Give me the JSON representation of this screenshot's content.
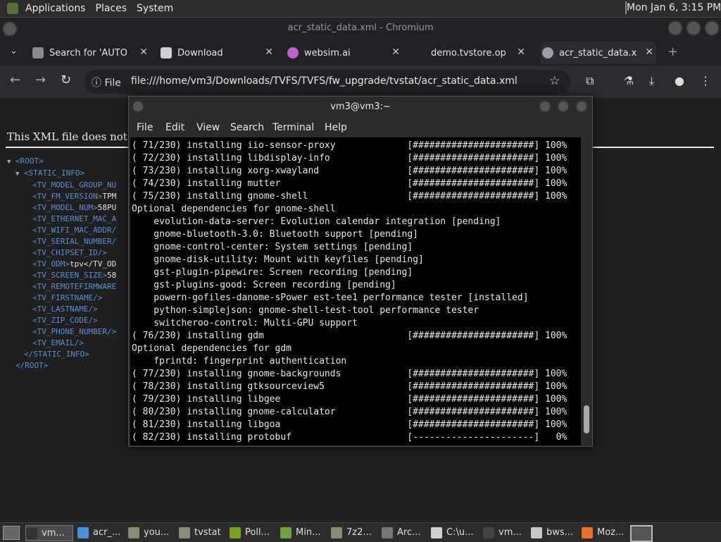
{
  "top_panel": {
    "menus": [
      "Applications",
      "Places",
      "System"
    ],
    "clock": "Mon Jan  6,  3:15 PM"
  },
  "browser": {
    "window_title": "acr_static_data.xml - Chromium",
    "tabs": [
      {
        "label": "Search for 'AUTOP",
        "icon": "puzzle-icon",
        "color": "#8a8a8a"
      },
      {
        "label": "Download",
        "icon": "tvfs-icon",
        "color": "#d0d0d0"
      },
      {
        "label": "websim.ai",
        "icon": "websim-icon",
        "color": "#c060d0"
      },
      {
        "label": "demo.tvstore.oper",
        "icon": "blank-icon",
        "color": "#202124"
      },
      {
        "label": "acr_static_data.xm",
        "icon": "globe-icon",
        "color": "#9aa0a6"
      }
    ],
    "info_label": "File",
    "url": "file:///home/vm3/Downloads/TVFS/TVFS/fw_upgrade/tvstat/acr_static_data.xml"
  },
  "xml_page": {
    "message": "This XML file does not app",
    "lines": [
      {
        "indent": 0,
        "tri": "▼",
        "text": "<ROOT>",
        "value": ""
      },
      {
        "indent": 1,
        "tri": "▼",
        "text": "<STATIC_INFO>",
        "value": ""
      },
      {
        "indent": 2,
        "tri": "",
        "text": "<TV_MODEL_GROUP_NU",
        "value": ""
      },
      {
        "indent": 2,
        "tri": "",
        "text": "<TV_FM_VERSION>",
        "value": "TPM"
      },
      {
        "indent": 2,
        "tri": "",
        "text": "<TV_MODEL_NUM>",
        "value": "58PU"
      },
      {
        "indent": 2,
        "tri": "",
        "text": "<TV_ETHERNET_MAC_A",
        "value": ""
      },
      {
        "indent": 2,
        "tri": "",
        "text": "<TV_WIFI_MAC_ADDR/",
        "value": ""
      },
      {
        "indent": 2,
        "tri": "",
        "text": "<TV_SERIAL_NUMBER/",
        "value": ""
      },
      {
        "indent": 2,
        "tri": "",
        "text": "<TV_CHIPSET_ID/>",
        "value": ""
      },
      {
        "indent": 2,
        "tri": "",
        "text": "<TV_ODM>",
        "value": "tpv</TV_OD"
      },
      {
        "indent": 2,
        "tri": "",
        "text": "<TV_SCREEN_SIZE>",
        "value": "58"
      },
      {
        "indent": 2,
        "tri": "",
        "text": "<TV_REMOTEFIRMWARE",
        "value": ""
      },
      {
        "indent": 2,
        "tri": "",
        "text": "<TV_FIRSTNAME/>",
        "value": ""
      },
      {
        "indent": 2,
        "tri": "",
        "text": "<TV_LASTNAME/>",
        "value": ""
      },
      {
        "indent": 2,
        "tri": "",
        "text": "<TV_ZIP_CODE/>",
        "value": ""
      },
      {
        "indent": 2,
        "tri": "",
        "text": "<TV_PHONE_NUMBER/>",
        "value": ""
      },
      {
        "indent": 2,
        "tri": "",
        "text": "<TV_EMAIL/>",
        "value": ""
      },
      {
        "indent": 1,
        "tri": "",
        "text": "</STATIC_INFO>",
        "value": ""
      },
      {
        "indent": 0,
        "tri": "",
        "text": "</ROOT>",
        "value": ""
      }
    ]
  },
  "terminal": {
    "title": "vm3@vm3:~",
    "menus": [
      "File",
      "Edit",
      "View",
      "Search",
      "Terminal",
      "Help"
    ],
    "lines": [
      "( 71/230) installing iio-sensor-proxy             [######################] 100%",
      "( 72/230) installing libdisplay-info              [######################] 100%",
      "( 73/230) installing xorg-xwayland                [######################] 100%",
      "( 74/230) installing mutter                       [######################] 100%",
      "( 75/230) installing gnome-shell                  [######################] 100%",
      "Optional dependencies for gnome-shell",
      "    evolution-data-server: Evolution calendar integration [pending]",
      "    gnome-bluetooth-3.0: Bluetooth support [pending]",
      "    gnome-control-center: System settings [pending]",
      "    gnome-disk-utility: Mount with keyfiles [pending]",
      "    gst-plugin-pipewire: Screen recording [pending]",
      "    gst-plugins-good: Screen recording [pending]",
      "    powern-gofiles-danome-sPower est-tee1 performance tester [installed]",
      "    python-simplejson: gnome-shell-test-tool performance tester",
      "    switcheroo-control: Multi-GPU support",
      "( 76/230) installing gdm                          [######################] 100%",
      "Optional dependencies for gdm",
      "    fprintd: fingerprint authentication",
      "( 77/230) installing gnome-backgrounds            [######################] 100%",
      "( 78/230) installing gtksourceview5               [######################] 100%",
      "( 79/230) installing libgee                       [######################] 100%",
      "( 80/230) installing gnome-calculator             [######################] 100%",
      "( 81/230) installing libgoa                       [######################] 100%",
      "( 82/230) installing protobuf                     [----------------------]   0%"
    ]
  },
  "taskbar": {
    "items": [
      {
        "label": "vm...",
        "icon": "terminal-icon",
        "color": "#333333",
        "active": true
      },
      {
        "label": "acr_...",
        "icon": "chromium-icon",
        "color": "#4a8fd8",
        "active": false
      },
      {
        "label": "you...",
        "icon": "folder-icon",
        "color": "#8a8a7a",
        "active": false
      },
      {
        "label": "tvstat",
        "icon": "folder-icon",
        "color": "#8a8a7a",
        "active": false
      },
      {
        "label": "Poll...",
        "icon": "poll-icon",
        "color": "#7aa020",
        "active": false
      },
      {
        "label": "Min...",
        "icon": "cube-icon",
        "color": "#70a040",
        "active": false
      },
      {
        "label": "7z2...",
        "icon": "folder-icon",
        "color": "#8a8a7a",
        "active": false
      },
      {
        "label": "Arc...",
        "icon": "archive-icon",
        "color": "#777777",
        "active": false
      },
      {
        "label": "C:\\u...",
        "icon": "cmd-icon",
        "color": "#d0d0d0",
        "active": false
      },
      {
        "label": "vm...",
        "icon": "terminal-icon",
        "color": "#444444",
        "active": false
      },
      {
        "label": "bws...",
        "icon": "editor-icon",
        "color": "#c8c8c8",
        "active": false
      },
      {
        "label": "Moz...",
        "icon": "firefox-icon",
        "color": "#e8702a",
        "active": false
      }
    ]
  }
}
